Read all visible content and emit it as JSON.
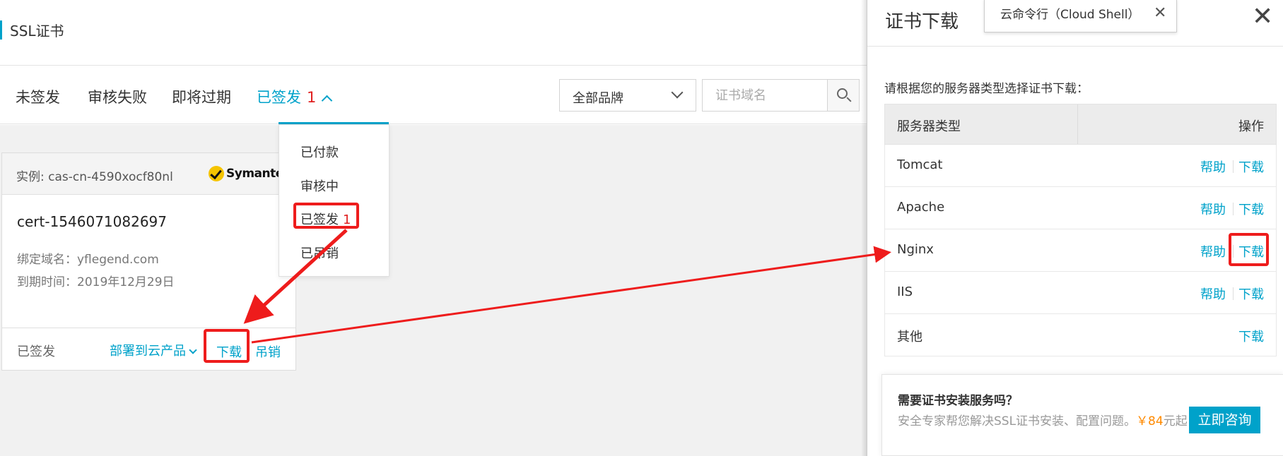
{
  "header": {
    "title": "SSL证书"
  },
  "tabs": [
    {
      "label": "未签发"
    },
    {
      "label": "审核失败"
    },
    {
      "label": "即将过期"
    },
    {
      "label": "已签发",
      "count": "1",
      "active": true
    }
  ],
  "filters": {
    "brand_label": "全部品牌",
    "search_placeholder": "证书域名"
  },
  "dropdown": {
    "items": [
      {
        "label": "已付款"
      },
      {
        "label": "审核中"
      },
      {
        "label": "已签发",
        "count": "1"
      },
      {
        "label": "已吊销"
      }
    ]
  },
  "card": {
    "instance": "实例: cas-cn-4590xocf80nl",
    "brand": "Symantec",
    "cert_name": "cert-1546071082697",
    "domain_label": "绑定域名：",
    "domain": "yflegend.com",
    "expiry_label": "到期时间：",
    "expiry": "2019年12月29日",
    "status": "已签发",
    "deploy_label": "部署到云产品",
    "download_label": "下载",
    "revoke_label": "吊销"
  },
  "panel": {
    "title": "证书下载",
    "shell_tab": "云命令行（Cloud Shell）",
    "prompt": "请根据您的服务器类型选择证书下载：",
    "table_header": {
      "type": "服务器类型",
      "action": "操作"
    },
    "rows": [
      {
        "name": "Tomcat",
        "help": "帮助",
        "download": "下载"
      },
      {
        "name": "Apache",
        "help": "帮助",
        "download": "下载"
      },
      {
        "name": "Nginx",
        "help": "帮助",
        "download": "下载"
      },
      {
        "name": "IIS",
        "help": "帮助",
        "download": "下载"
      },
      {
        "name": "其他",
        "download": "下载"
      }
    ],
    "service": {
      "heading": "需要证书安装服务吗？",
      "desc_prefix": "安全专家帮您解决SSL证书安装、配置问题。",
      "price": "￥84",
      "desc_suffix": "元起",
      "button": "立即咨询"
    }
  },
  "colors": {
    "accent": "#00a2ca",
    "count_red": "#e02020",
    "annotation_red": "#ee1c1c",
    "price_orange": "#ff8a00"
  }
}
